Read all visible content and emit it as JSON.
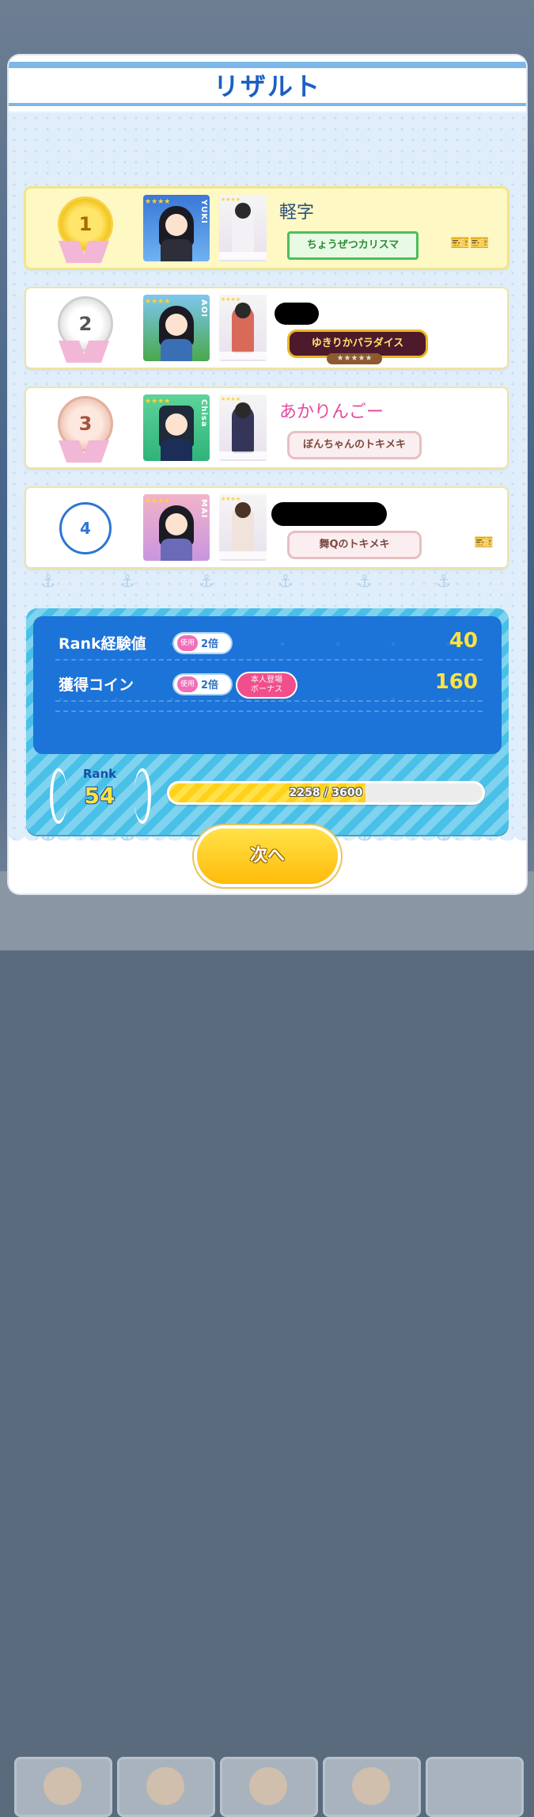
{
  "panel": {
    "title": "リザルト"
  },
  "players": [
    {
      "rank": "1",
      "name": "軽字",
      "avatar_tag": "YUKI",
      "title_badge": "ちょうぜつカリスマ",
      "tickets": "🎫🎫"
    },
    {
      "rank": "2",
      "name": "",
      "avatar_tag": "AOI",
      "title_badge": "ゆきりかパラダイス",
      "badge_stars": "★★★★★"
    },
    {
      "rank": "3",
      "name": "あかりんごー",
      "avatar_tag": "Chisa",
      "title_badge": "ぼんちゃんのトキメキ"
    },
    {
      "rank": "4",
      "name": "",
      "avatar_tag": "MAI",
      "title_badge": "舞Qのトキメキ",
      "tickets": "🎫"
    }
  ],
  "stats": {
    "rank_exp_label": "Rank経験値",
    "rank_exp_use": "使用",
    "rank_exp_mult": "2倍",
    "rank_exp_value": "40",
    "coin_label": "獲得コイン",
    "coin_use": "使用",
    "coin_mult": "2倍",
    "coin_bonus": "本人登場\nボーナス",
    "coin_value": "160"
  },
  "rank": {
    "word": "Rank",
    "level": "54",
    "exp_text": "2258 / 3600",
    "exp_fraction": 0.627
  },
  "footer": {
    "next_label": "次へ"
  },
  "colors": {
    "accent_blue": "#1c73d8",
    "gold": "#ffe33d",
    "button_yellow": "#ffbb0a"
  }
}
